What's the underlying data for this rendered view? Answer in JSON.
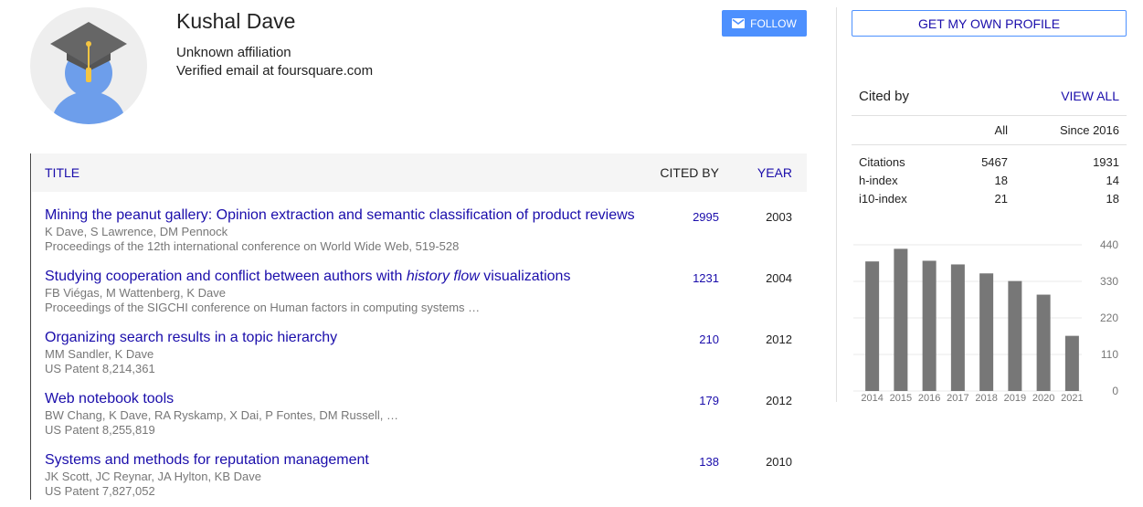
{
  "profile": {
    "name": "Kushal Dave",
    "affiliation": "Unknown affiliation",
    "email": "Verified email at foursquare.com",
    "follow_label": "FOLLOW"
  },
  "table": {
    "headers": {
      "title": "TITLE",
      "cited_by": "CITED BY",
      "year": "YEAR"
    },
    "rows": [
      {
        "title_before": "Mining the peanut gallery: Opinion extraction and semantic classification of product reviews",
        "title_italic": "",
        "title_after": "",
        "authors": "K Dave, S Lawrence, DM Pennock",
        "venue": "Proceedings of the 12th international conference on World Wide Web, 519-528",
        "cited_by": "2995",
        "year": "2003"
      },
      {
        "title_before": "Studying cooperation and conflict between authors with ",
        "title_italic": "history flow",
        "title_after": " visualizations",
        "authors": "FB Viégas, M Wattenberg, K Dave",
        "venue": "Proceedings of the SIGCHI conference on Human factors in computing systems …",
        "cited_by": "1231",
        "year": "2004"
      },
      {
        "title_before": "Organizing search results in a topic hierarchy",
        "title_italic": "",
        "title_after": "",
        "authors": "MM Sandler, K Dave",
        "venue": "US Patent 8,214,361",
        "cited_by": "210",
        "year": "2012"
      },
      {
        "title_before": "Web notebook tools",
        "title_italic": "",
        "title_after": "",
        "authors": "BW Chang, K Dave, RA Ryskamp, X Dai, P Fontes, DM Russell, …",
        "venue": "US Patent 8,255,819",
        "cited_by": "179",
        "year": "2012"
      },
      {
        "title_before": "Systems and methods for reputation management",
        "title_italic": "",
        "title_after": "",
        "authors": "JK Scott, JC Reynar, JA Hylton, KB Dave",
        "venue": "US Patent 7,827,052",
        "cited_by": "138",
        "year": "2010"
      }
    ]
  },
  "sidebar": {
    "own_profile_label": "GET MY OWN PROFILE",
    "cited_by_heading": "Cited by",
    "view_all_label": "VIEW ALL",
    "col_all": "All",
    "col_since": "Since 2016",
    "stats": [
      {
        "label": "Citations",
        "all": "5467",
        "since": "1931"
      },
      {
        "label": "h-index",
        "all": "18",
        "since": "14"
      },
      {
        "label": "i10-index",
        "all": "21",
        "since": "18"
      }
    ]
  },
  "colors": {
    "link": "#1a0dab",
    "accent": "#4d90fe",
    "bar": "#777777"
  },
  "chart_data": {
    "type": "bar",
    "categories": [
      "2014",
      "2015",
      "2016",
      "2017",
      "2018",
      "2019",
      "2020",
      "2021"
    ],
    "values": [
      390,
      428,
      392,
      381,
      354,
      331,
      290,
      166
    ],
    "ylim": [
      0,
      440
    ],
    "yticks": [
      "0",
      "110",
      "220",
      "330",
      "440"
    ],
    "grid": true,
    "axis_position": "right"
  }
}
